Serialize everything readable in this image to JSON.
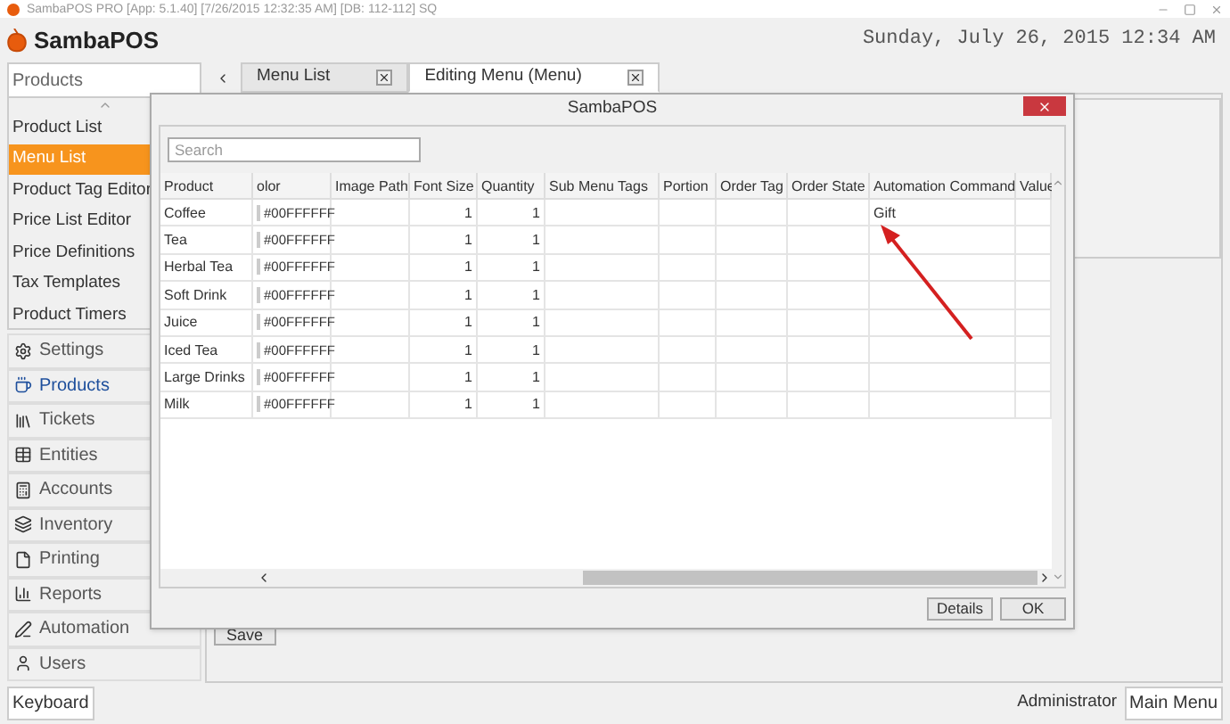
{
  "window": {
    "title": "SambaPOS PRO [App: 5.1.40] [7/26/2015 12:32:35 AM] [DB: 112-112] SQ"
  },
  "logo": "SambaPOS",
  "clock": "Sunday, July 26, 2015 12:34 AM",
  "sidebar": {
    "header": "Products",
    "items": [
      {
        "label": "Product List",
        "selected": false
      },
      {
        "label": "Menu List",
        "selected": true
      },
      {
        "label": "Product Tag Editor",
        "selected": false
      },
      {
        "label": "Price List Editor",
        "selected": false
      },
      {
        "label": "Price Definitions",
        "selected": false
      },
      {
        "label": "Tax Templates",
        "selected": false
      },
      {
        "label": "Product Timers",
        "selected": false
      }
    ],
    "modules": [
      {
        "label": "Settings",
        "selected": false
      },
      {
        "label": "Products",
        "selected": true
      },
      {
        "label": "Tickets",
        "selected": false
      },
      {
        "label": "Entities",
        "selected": false
      },
      {
        "label": "Accounts",
        "selected": false
      },
      {
        "label": "Inventory",
        "selected": false
      },
      {
        "label": "Printing",
        "selected": false
      },
      {
        "label": "Reports",
        "selected": false
      },
      {
        "label": "Automation",
        "selected": false
      },
      {
        "label": "Users",
        "selected": false
      }
    ]
  },
  "tabs": [
    {
      "label": "Menu List",
      "selected": false
    },
    {
      "label": "Editing Menu (Menu)",
      "selected": true
    }
  ],
  "save_button": "Save",
  "dialog": {
    "title": "SambaPOS",
    "search": {
      "placeholder": "Search"
    },
    "columns": [
      "Product",
      "olor",
      "Image Path",
      "Font Size",
      "Quantity",
      "Sub Menu Tags",
      "Portion",
      "Order Tag",
      "Order State",
      "Automation Command",
      "Value"
    ],
    "rows": [
      {
        "product": "Coffee",
        "color_code": "#00FFFFFF",
        "font_size": "1",
        "quantity": "1",
        "automation_command": "Gift"
      },
      {
        "product": "Tea",
        "color_code": "#00FFFFFF",
        "font_size": "1",
        "quantity": "1"
      },
      {
        "product": "Herbal Tea",
        "color_code": "#00FFFFFF",
        "font_size": "1",
        "quantity": "1"
      },
      {
        "product": "Soft Drink",
        "color_code": "#00FFFFFF",
        "font_size": "1",
        "quantity": "1"
      },
      {
        "product": "Juice",
        "color_code": "#00FFFFFF",
        "font_size": "1",
        "quantity": "1"
      },
      {
        "product": "Iced Tea",
        "color_code": "#00FFFFFF",
        "font_size": "1",
        "quantity": "1"
      },
      {
        "product": "Large Drinks",
        "color_code": "#00FFFFFF",
        "font_size": "1",
        "quantity": "1"
      },
      {
        "product": "Milk",
        "color_code": "#00FFFFFF",
        "font_size": "1",
        "quantity": "1"
      }
    ],
    "buttons": [
      "Details",
      "OK"
    ]
  },
  "status_bar": {
    "keyboard": "Keyboard",
    "user": "Administrator",
    "main_menu": "Main Menu"
  }
}
